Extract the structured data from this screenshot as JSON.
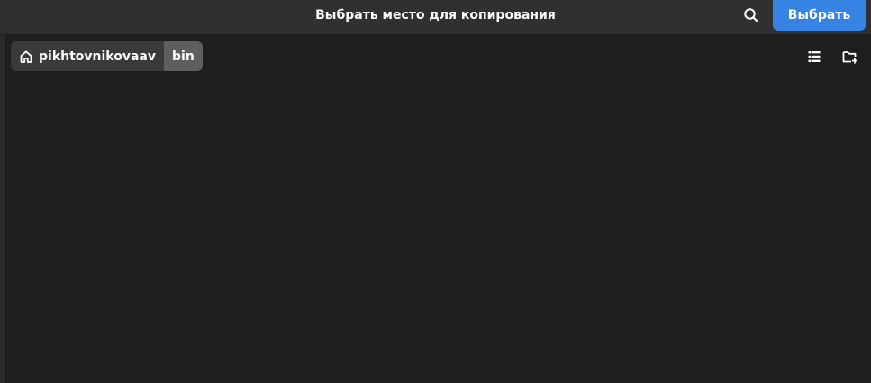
{
  "window": {
    "title": "Выбрать место для копирования"
  },
  "header": {
    "search_icon": "search-icon",
    "primary_button_label": "Выбрать"
  },
  "pathbar": {
    "home_icon": "home-icon",
    "home_label": "pikhtovnikovaav",
    "current_label": "bin"
  },
  "toolbar": {
    "view_toggle_icon": "list-view-icon",
    "new_folder_icon": "new-folder-icon"
  },
  "colors": {
    "accent": "#3584e4",
    "header_bg": "#303030",
    "content_bg": "#1e1e1e",
    "crumb_bg": "#3a3a3a",
    "crumb_active_bg": "#5e5e5e"
  }
}
